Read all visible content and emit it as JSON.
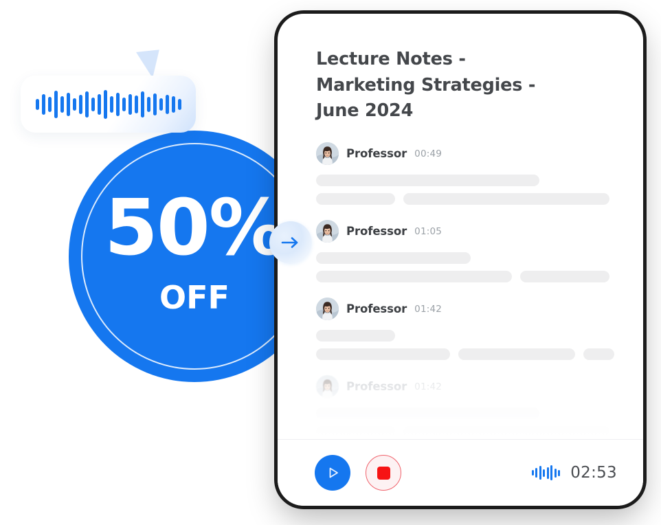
{
  "promo": {
    "percent": "50%",
    "off_label": "OFF",
    "arrow_icon": "arrow-right-icon",
    "accent_color": "#1577ef",
    "wave_icon": "audio-waveform-icon",
    "wave_bars": [
      16,
      30,
      22,
      40,
      24,
      34,
      18,
      28,
      38,
      20,
      30,
      42,
      24,
      34,
      20,
      30,
      26,
      38,
      22,
      32,
      18,
      28,
      24,
      16
    ]
  },
  "note_card": {
    "title": "Lecture Notes - Marketing Strategies - June 2024",
    "entries": [
      {
        "avatar_icon": "avatar-professor",
        "speaker": "Professor",
        "timestamp": "00:49",
        "faded": false,
        "lines": [
          [
            325
          ],
          [
            115,
            300
          ]
        ]
      },
      {
        "avatar_icon": "avatar-professor",
        "speaker": "Professor",
        "timestamp": "01:05",
        "faded": false,
        "lines": [
          [
            225
          ],
          [
            285,
            130
          ]
        ]
      },
      {
        "avatar_icon": "avatar-professor",
        "speaker": "Professor",
        "timestamp": "01:42",
        "faded": false,
        "lines": [
          [
            115
          ],
          [
            195,
            170,
            45
          ]
        ]
      },
      {
        "avatar_icon": "avatar-professor",
        "speaker": "Professor",
        "timestamp": "01:42",
        "faded": true,
        "lines": [
          [
            325
          ],
          [
            115,
            300
          ]
        ]
      }
    ],
    "player": {
      "play_label": "Play",
      "play_icon": "play-icon",
      "stop_label": "Stop",
      "stop_icon": "stop-icon",
      "wave_icon": "audio-waveform-icon",
      "wave_bars": [
        8,
        14,
        20,
        11,
        17,
        22,
        13,
        9
      ],
      "time": "02:53",
      "accent_color": "#1577ef",
      "stop_color": "#f61414"
    }
  }
}
